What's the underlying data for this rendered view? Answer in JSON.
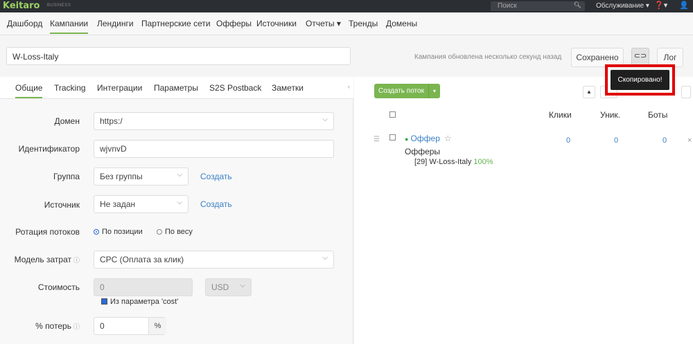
{
  "topbar": {
    "logo": "Keitaro",
    "logo_sub": "BUSINESS",
    "search_placeholder": "Поиск",
    "service_menu": "Обслуживание ▾",
    "help": "❓▾",
    "user": "👤"
  },
  "nav": {
    "items": [
      "Дашборд",
      "Кампании",
      "Лендинги",
      "Партнерские сети",
      "Офферы",
      "Источники",
      "Отчеты ▾",
      "Тренды",
      "Домены"
    ]
  },
  "campaign": {
    "name": "W-Loss-Italy",
    "updated_text": "Кампания обновлена несколько секунд назад",
    "saved_label": "Сохранено",
    "log_label": "Лог",
    "tooltip": "Скопировано!"
  },
  "tabs": [
    "Общие",
    "Tracking",
    "Интеграции",
    "Параметры",
    "S2S Postback",
    "Заметки"
  ],
  "form": {
    "domain_label": "Домен",
    "domain_value": "https:/",
    "id_label": "Идентификатор",
    "id_value": "wjvnvD",
    "group_label": "Группа",
    "group_value": "Без группы",
    "source_label": "Источник",
    "source_value": "Не задан",
    "create_link": "Создать",
    "rotation_label": "Ротация потоков",
    "rotation_pos": "По позиции",
    "rotation_weight": "По весу",
    "cost_model_label": "Модель затрат",
    "cost_model_value": "CPC (Оплата за клик)",
    "cost_label": "Стоимость",
    "cost_value": "0",
    "currency": "USD",
    "cost_param": "Из параметра 'cost'",
    "loss_label": "% потерь",
    "loss_value": "0",
    "loss_unit": "%"
  },
  "flows": {
    "create_button": "Создать поток",
    "headers": [
      "Клики",
      "Уник.",
      "Боты"
    ],
    "row": {
      "name": "Оффер",
      "offers_label": "Офферы",
      "offer_item": "[29] W-Loss-Italy",
      "offer_pct": "100%",
      "clicks": "0",
      "unique": "0",
      "bots": "0"
    }
  }
}
